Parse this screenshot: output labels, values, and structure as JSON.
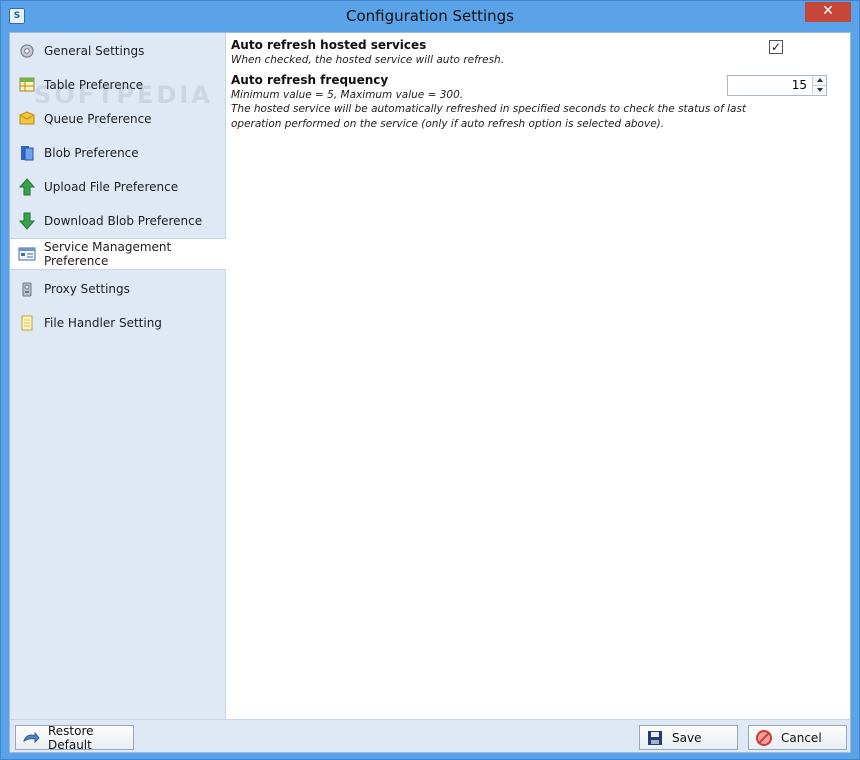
{
  "window": {
    "title": "Configuration Settings",
    "close_glyph": "✕",
    "app_icon_text": "S"
  },
  "sidebar": {
    "items": [
      {
        "label": "General Settings",
        "icon": "gear-icon"
      },
      {
        "label": "Table Preference",
        "icon": "table-icon"
      },
      {
        "label": "Queue Preference",
        "icon": "queue-icon"
      },
      {
        "label": "Blob Preference",
        "icon": "blob-icon"
      },
      {
        "label": "Upload File Preference",
        "icon": "upload-arrow-icon"
      },
      {
        "label": "Download Blob Preference",
        "icon": "download-arrow-icon"
      },
      {
        "label": "Service Management Preference",
        "icon": "service-window-icon",
        "active": true
      },
      {
        "label": "Proxy Settings",
        "icon": "proxy-icon"
      },
      {
        "label": "File Handler Setting",
        "icon": "file-icon"
      }
    ]
  },
  "content": {
    "auto_refresh": {
      "title": "Auto refresh hosted services",
      "hint": "When checked, the hosted service will auto refresh.",
      "checked": true,
      "check_glyph": "✓"
    },
    "frequency": {
      "title": "Auto refresh frequency",
      "range_hint": "Minimum value = 5, Maximum value = 300.",
      "description_line1": "The hosted service will be automatically refreshed in specified seconds to check the status of last",
      "description_line2": "operation performed on the service (only if auto refresh option is selected above).",
      "value": "15"
    }
  },
  "footer": {
    "restore_label": "Restore Default",
    "save_label": "Save",
    "cancel_label": "Cancel"
  },
  "watermark": "SOFTPEDIA",
  "colors": {
    "titlebar": "#5aa3e8",
    "sidebar": "#dfe9f5",
    "close": "#c7463a"
  }
}
